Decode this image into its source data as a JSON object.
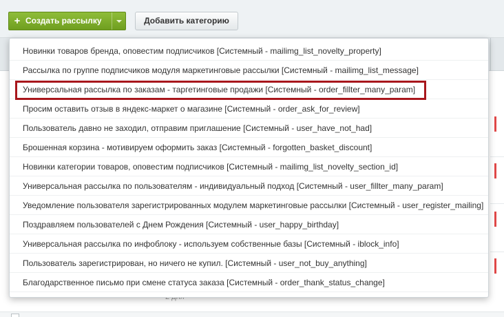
{
  "toolbar": {
    "create_button_label": "Создать рассылку",
    "add_category_label": "Добавить категорию"
  },
  "background": {
    "peek_text": "2 дня"
  },
  "menu": {
    "items": [
      {
        "label": "Новинки товаров бренда, оповестим подписчиков [Системный - mailimg_list_novelty_property]"
      },
      {
        "label": "Рассылка по группе подписчиков модуля маркетинговые рассылки [Системный - mailimg_list_message]"
      },
      {
        "label": "Универсальная рассылка по заказам - таргетинговые продажи [Системный - order_fillter_many_param]"
      },
      {
        "label": "Просим оставить отзыв в яндекс-маркет о магазине [Системный - order_ask_for_review]"
      },
      {
        "label": "Пользователь давно не заходил, отправим приглашение [Системный - user_have_not_had]"
      },
      {
        "label": "Брошенная корзина - мотивируем оформить заказ [Системный - forgotten_basket_discount]"
      },
      {
        "label": "Новинки категории товаров, оповестим подписчиков [Системный - mailimg_list_novelty_section_id]"
      },
      {
        "label": "Универсальная рассылка по пользователям - индивидуальный подход [Системный - user_fillter_many_param]"
      },
      {
        "label": "Уведомление пользователя зарегистрированных модулем маркетинговые рассылки [Системный - user_register_mailing]"
      },
      {
        "label": "Поздравляем пользователей с Днем Рождения [Системный - user_happy_birthday]"
      },
      {
        "label": "Универсальная рассылка по инфоблоку - используем собственные базы [Системный - iblock_info]"
      },
      {
        "label": "Пользователь зарегистрирован, но ничего не купил. [Системный - user_not_buy_anything]"
      },
      {
        "label": "Благодарственное письмо при смене статуса заказа [Системный - order_thank_status_change]"
      }
    ],
    "highlighted_index": 2
  },
  "colors": {
    "accent_green": "#7aa82a",
    "highlight_border": "#a8161c",
    "status_red": "#e04848"
  }
}
